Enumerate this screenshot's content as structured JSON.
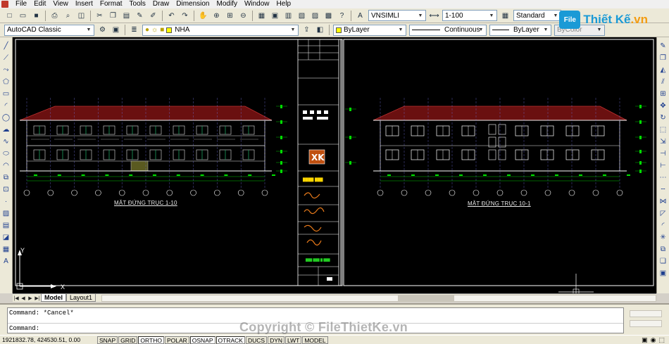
{
  "menu": [
    "File",
    "Edit",
    "View",
    "Insert",
    "Format",
    "Tools",
    "Draw",
    "Dimension",
    "Modify",
    "Window",
    "Help"
  ],
  "toolbar1": {
    "text_style": "VNSIMLI",
    "dim_style": "1-100",
    "table_style": "Standard"
  },
  "toolbar2": {
    "workspace": "AutoCAD Classic",
    "layer": "NHA",
    "color": "ByLayer",
    "linetype": "Continuous",
    "lineweight": "ByLayer",
    "plotstyle": "ByColor"
  },
  "logo": {
    "mark": "File",
    "brand": "Thiết Kế",
    "tld": ".vn"
  },
  "drawing": {
    "left_caption": "MẶT ĐỨNG TRỤC 1-10",
    "right_caption": "MẶT ĐỨNG TRỤC 10-1",
    "ucs_y": "Y",
    "ucs_x": "X"
  },
  "layout_tabs": [
    "Model",
    "Layout1"
  ],
  "command": {
    "history": "Command: *Cancel*",
    "prompt": "Command:"
  },
  "watermark": "Copyright © FileThietKe.vn",
  "status": {
    "coords": "1921832.78, 424530.51, 0.00",
    "toggles": [
      "SNAP",
      "GRID",
      "ORTHO",
      "POLAR",
      "OSNAP",
      "OTRACK",
      "DUCS",
      "DYN",
      "LWT",
      "MODEL"
    ]
  },
  "colors": {
    "canvas": "#000000",
    "roof": "#8b1a1a",
    "building": "#e8e8e8",
    "dimension": "#00c000",
    "frame": "#ffffff"
  }
}
